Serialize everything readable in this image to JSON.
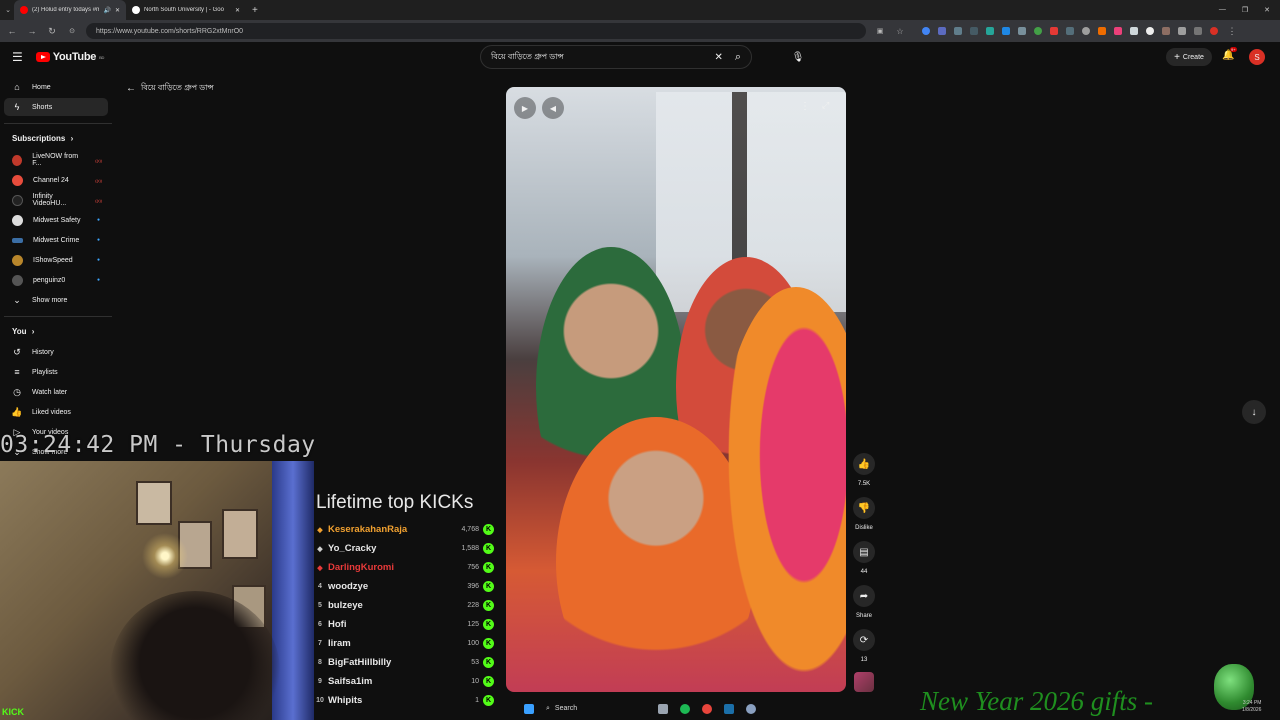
{
  "browser": {
    "tabs": [
      {
        "label": "(2) Holud entry todays #m",
        "active": true
      },
      {
        "label": "North South University | - Goo",
        "active": false
      }
    ],
    "new_tab": "+",
    "url": "https://www.youtube.com/shorts/RRG2xtMnrO0"
  },
  "youtube": {
    "logo": "YouTube",
    "logo_sup": "BD",
    "search_value": "বিয়ে বাড়িতে গ্রুপ ডান্স",
    "create_label": "Create",
    "notification_count": "9+",
    "avatar_letter": "S",
    "back_title": "বিয়ে বাড়িতে গ্রুপ ডান্স"
  },
  "sidebar": {
    "main": [
      {
        "label": "Home",
        "icon": "home-icon"
      },
      {
        "label": "Shorts",
        "icon": "shorts-icon",
        "selected": true
      }
    ],
    "subscriptions_title": "Subscriptions",
    "subscriptions": [
      {
        "label": "LiveNOW from F...",
        "status": "live",
        "color": "#c0392b"
      },
      {
        "label": "Channel 24",
        "status": "live",
        "color": "#e74c3c"
      },
      {
        "label": "Infinity VideoHU...",
        "status": "live",
        "color": "#222222"
      },
      {
        "label": "Midwest Safety",
        "status": "new",
        "color": "#dddddd"
      },
      {
        "label": "Midwest Crime",
        "status": "new",
        "color": "#3b6ea5"
      },
      {
        "label": "IShowSpeed",
        "status": "new",
        "color": "#b8862b"
      },
      {
        "label": "penguinz0",
        "status": "new",
        "color": "#555555"
      }
    ],
    "show_more": "Show more",
    "you_title": "You",
    "you": [
      {
        "label": "History",
        "icon": "history-icon"
      },
      {
        "label": "Playlists",
        "icon": "playlists-icon"
      },
      {
        "label": "Watch later",
        "icon": "watch-later-icon"
      },
      {
        "label": "Liked videos",
        "icon": "liked-videos-icon"
      },
      {
        "label": "Your videos",
        "icon": "your-videos-icon"
      }
    ],
    "show_more_2": "Show more"
  },
  "shorts": {
    "actions": [
      {
        "name": "like",
        "icon": "thumbs-up-icon",
        "label": "7.5K"
      },
      {
        "name": "dislike",
        "icon": "thumbs-down-icon",
        "label": "Dislike"
      },
      {
        "name": "comments",
        "icon": "comment-icon",
        "label": "44"
      },
      {
        "name": "share",
        "icon": "share-icon",
        "label": "Share"
      },
      {
        "name": "remix",
        "icon": "remix-icon",
        "label": "13"
      }
    ]
  },
  "overlay": {
    "clock": "03:24:42 PM - Thursday",
    "kick_title": "Lifetime top KICKs",
    "kick_logo": "KICK",
    "kicks": [
      {
        "rank": "",
        "name": "KeserakahanRaja",
        "value": "4,768",
        "color": "#f0a030"
      },
      {
        "rank": "",
        "name": "Yo_Cracky",
        "value": "1,588",
        "color": "#e8e8e8"
      },
      {
        "rank": "",
        "name": "DarlingKuromi",
        "value": "756",
        "color": "#e83a3a"
      },
      {
        "rank": "4",
        "name": "woodzye",
        "value": "396",
        "color": "#e8e8e8"
      },
      {
        "rank": "5",
        "name": "bulzeye",
        "value": "228",
        "color": "#e8e8e8"
      },
      {
        "rank": "6",
        "name": "Hofi",
        "value": "125",
        "color": "#e8e8e8"
      },
      {
        "rank": "7",
        "name": "Iiram",
        "value": "100",
        "color": "#e8e8e8"
      },
      {
        "rank": "8",
        "name": "BigFatHillbilly",
        "value": "53",
        "color": "#e8e8e8"
      },
      {
        "rank": "9",
        "name": "Saifsa1im",
        "value": "10",
        "color": "#e8e8e8"
      },
      {
        "rank": "10",
        "name": "Whipits",
        "value": "1",
        "color": "#e8e8e8"
      }
    ],
    "new_year": "New Year 2026 gifts -"
  },
  "taskbar": {
    "search": "Search",
    "time": "3:24 PM",
    "date": "1/8/2026"
  }
}
